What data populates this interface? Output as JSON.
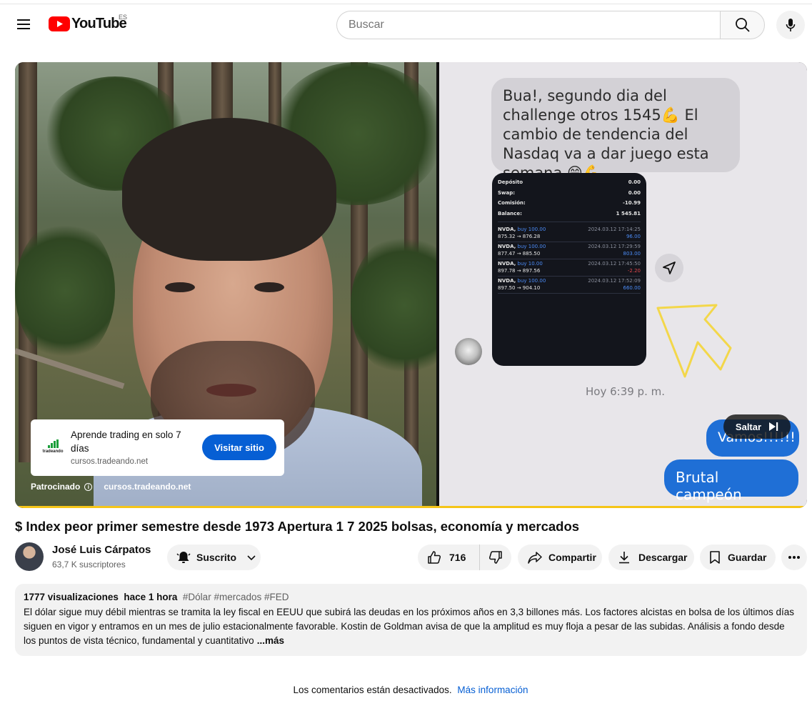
{
  "header": {
    "logo_text": "YouTube",
    "country_code": "ES",
    "search_placeholder": "Buscar"
  },
  "player": {
    "chat": {
      "message": "Bua!, segundo dia del challenge otros 1545💪  El cambio de tendencia del Nasdaq va a dar juego esta semana 😁💪",
      "account": [
        {
          "label": "Depósito",
          "value": "0.00"
        },
        {
          "label": "Swap:",
          "value": "0.00"
        },
        {
          "label": "Comisión:",
          "value": "-10.99"
        },
        {
          "label": "Balance:",
          "value": "1 545.81"
        }
      ],
      "trades": [
        {
          "symbol": "NVDA,",
          "action": "buy 100.00",
          "prices": "875.32 → 876.28",
          "date": "2024.03.12 17:14:25",
          "profit": "96.00",
          "profit_color": "blue"
        },
        {
          "symbol": "NVDA,",
          "action": "buy 100.00",
          "prices": "877.47 → 885.50",
          "date": "2024.03.12 17:29:59",
          "profit": "803.00",
          "profit_color": "blue"
        },
        {
          "symbol": "NVDA,",
          "action": "buy 10.00",
          "prices": "897.78 → 897.56",
          "date": "2024.03.12 17:45:50",
          "profit": "-2.20",
          "profit_color": "red"
        },
        {
          "symbol": "NVDA,",
          "action": "buy 100.00",
          "prices": "897.50 → 904.10",
          "date": "2024.03.12 17:52:09",
          "profit": "660.00",
          "profit_color": "blue"
        }
      ],
      "timestamp": "Hoy 6:39 p. m.",
      "reply_1": "Vamos!!!!!!",
      "reply_2": "Brutal campeón"
    },
    "ad": {
      "brand": "tradeando",
      "title": "Aprende trading en solo 7 días",
      "url": "cursos.tradeando.net",
      "visit_label": "Visitar sitio",
      "sponsored_label": "Patrocinado",
      "sponsored_url": "cursos.tradeando.net",
      "skip_label": "Saltar"
    },
    "progress_color": "#f5c518"
  },
  "video": {
    "title": "$ Index peor primer semestre desde 1973 Apertura 1 7 2025 bolsas, economía y mercados",
    "channel_name": "José Luis Cárpatos",
    "subscribers": "63,7 K suscriptores",
    "subscribed_label": "Suscrito",
    "likes": "716",
    "share_label": "Compartir",
    "download_label": "Descargar",
    "save_label": "Guardar"
  },
  "description": {
    "views": "1777 visualizaciones",
    "age": "hace 1 hora",
    "tags": "#Dólar #mercados #FED",
    "text": "El dólar sigue muy débil mientras se tramita la ley fiscal en EEUU que subirá las deudas en los próximos años en 3,3 billones más. Los factores alcistas en bolsa de los últimos días siguen en vigor y entramos en un mes de julio estacionalmente favorable. Kostin de Goldman avisa de que la amplitud es muy floja a pesar de las subidas. Análisis a fondo desde los puntos de vista técnico, fundamental y cuantitativo",
    "more_label": "...más"
  },
  "comments": {
    "disabled_text": "Los comentarios están desactivados.",
    "more_info_link": "Más información"
  },
  "colors": {
    "brand_red": "#ff0000",
    "accent_blue": "#065fd4"
  }
}
